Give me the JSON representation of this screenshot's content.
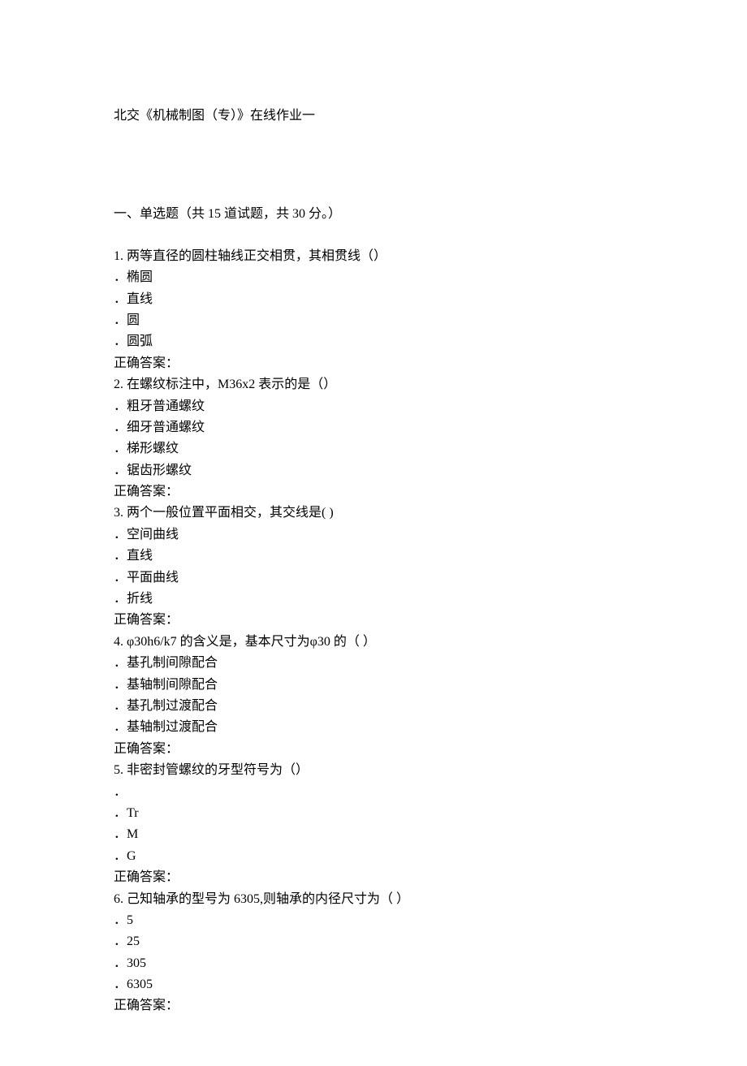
{
  "title": "北交《机械制图（专）》在线作业一",
  "section_header": "一、单选题（共 15 道试题，共 30 分。）",
  "questions": [
    {
      "num": "1.",
      "text": "两等直径的圆柱轴线正交相贯，其相贯线（）",
      "options": [
        "椭圆",
        "直线",
        "圆",
        "圆弧"
      ],
      "answer_label": "正确答案："
    },
    {
      "num": "2.",
      "text": "在螺纹标注中，M36x2 表示的是（）",
      "options": [
        "粗牙普通螺纹",
        "细牙普通螺纹",
        "梯形螺纹",
        "锯齿形螺纹"
      ],
      "answer_label": "正确答案："
    },
    {
      "num": "3.",
      "text": "两个一般位置平面相交，其交线是( )",
      "options": [
        "空间曲线",
        "直线",
        "平面曲线",
        "折线"
      ],
      "answer_label": "正确答案："
    },
    {
      "num": "4.",
      "text": "φ30h6/k7 的含义是，基本尺寸为φ30 的（ ）",
      "options": [
        "基孔制间隙配合",
        "基轴制间隙配合",
        "基孔制过渡配合",
        "基轴制过渡配合"
      ],
      "answer_label": "正确答案："
    },
    {
      "num": "5.",
      "text": "非密封管螺纹的牙型符号为（）",
      "options": [
        "",
        "Tr",
        "M",
        "G"
      ],
      "answer_label": "正确答案："
    },
    {
      "num": "6.",
      "text": "己知轴承的型号为 6305,则轴承的内径尺寸为（ ）",
      "options": [
        "5",
        "25",
        "305",
        "6305"
      ],
      "answer_label": "正确答案："
    }
  ]
}
